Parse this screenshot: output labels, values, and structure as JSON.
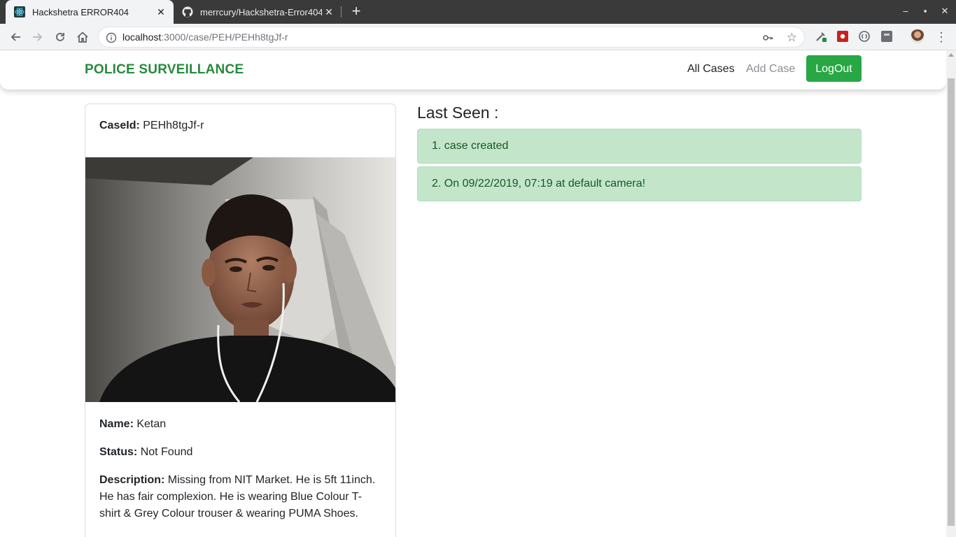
{
  "browser": {
    "tabs": [
      {
        "title": "Hackshetra ERROR404",
        "active": true,
        "icon": "react-icon"
      },
      {
        "title": "merrcury/Hackshetra-Error404",
        "active": false,
        "icon": "github-icon"
      }
    ],
    "url_host": "localhost",
    "url_rest": ":3000/case/PEH/PEHh8tgJf-r"
  },
  "navbar": {
    "brand": "POLICE SURVEILLANCE",
    "links": [
      "All Cases",
      "Add Case"
    ],
    "logout_label": "LogOut",
    "brand_color": "#28893d",
    "button_color": "#28a745"
  },
  "case": {
    "caseid_label": "CaseId:",
    "caseid_value": "PEHh8tgJf-r",
    "name_label": "Name:",
    "name_value": "Ketan",
    "status_label": "Status:",
    "status_value": "Not Found",
    "description_label": "Description:",
    "description_value": "Missing from NIT Market. He is 5ft 11inch. He has fair complexion. He is wearing Blue Colour T-shirt & Grey Colour trouser & wearing PUMA Shoes."
  },
  "last_seen": {
    "heading": "Last Seen :",
    "entries": [
      "1. case created",
      "2. On 09/22/2019, 07:19 at default camera!"
    ],
    "alert_bg": "#c3e6cb",
    "alert_text": "#155724"
  }
}
